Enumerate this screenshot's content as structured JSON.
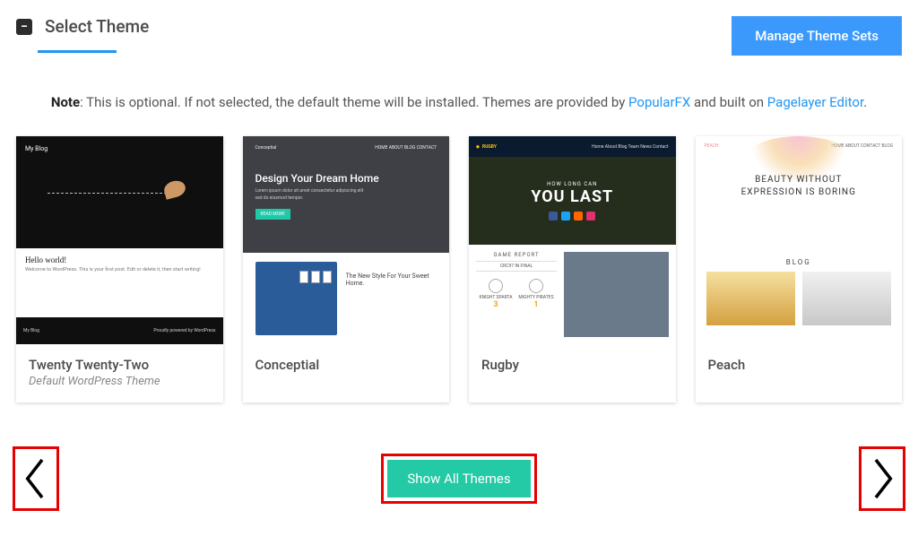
{
  "header": {
    "title": "Select Theme",
    "manage_button": "Manage Theme Sets",
    "collapse_icon": "minus-square-icon"
  },
  "note": {
    "bold": "Note",
    "text_before": ": This is optional. If not selected, the default theme will be installed. Themes are provided by ",
    "link1": "PopularFX",
    "text_mid": " and built on ",
    "link2": "Pagelayer Editor",
    "text_after": "."
  },
  "themes": [
    {
      "name": "Twenty Twenty-Two",
      "subtitle": "Default WordPress Theme",
      "preview": {
        "hello": "Hello world!",
        "blurb": "Welcome to WordPress. This is your first post. Edit or delete it, then start writing!",
        "brand": "My Blog",
        "footer_right": "Proudly powered by WordPress"
      }
    },
    {
      "name": "Conceptial",
      "preview": {
        "brand": "Conceptial",
        "nav": "HOME   ABOUT   BLOG   CONTACT",
        "hero": "Design Your Dream Home",
        "btn": "READ MORE",
        "bottom": "The New Style For Your Sweet Home."
      }
    },
    {
      "name": "Rugby",
      "preview": {
        "brand": "RUGBY",
        "nav": "Home  About  Blog  Team  News  Contact",
        "small": "HOW LONG CAN",
        "big": "YOU LAST",
        "report": "GAME REPORT",
        "sub": "CRC97 IN FINAL",
        "team_a": "KNIGHT SPARTA",
        "team_b": "MIGHTY PIRATES",
        "score_a": "3",
        "score_b": "1"
      }
    },
    {
      "name": "Peach",
      "preview": {
        "brand": "PEACH",
        "nav": "HOME   ABOUT   CONTACT   BLOG",
        "hero_l1": "BEAUTY WITHOUT",
        "hero_l2": "EXPRESSION IS BORING",
        "blog": "BLOG"
      }
    }
  ],
  "controls": {
    "show_all": "Show All Themes",
    "prev_icon": "chevron-left-icon",
    "next_icon": "chevron-right-icon"
  }
}
